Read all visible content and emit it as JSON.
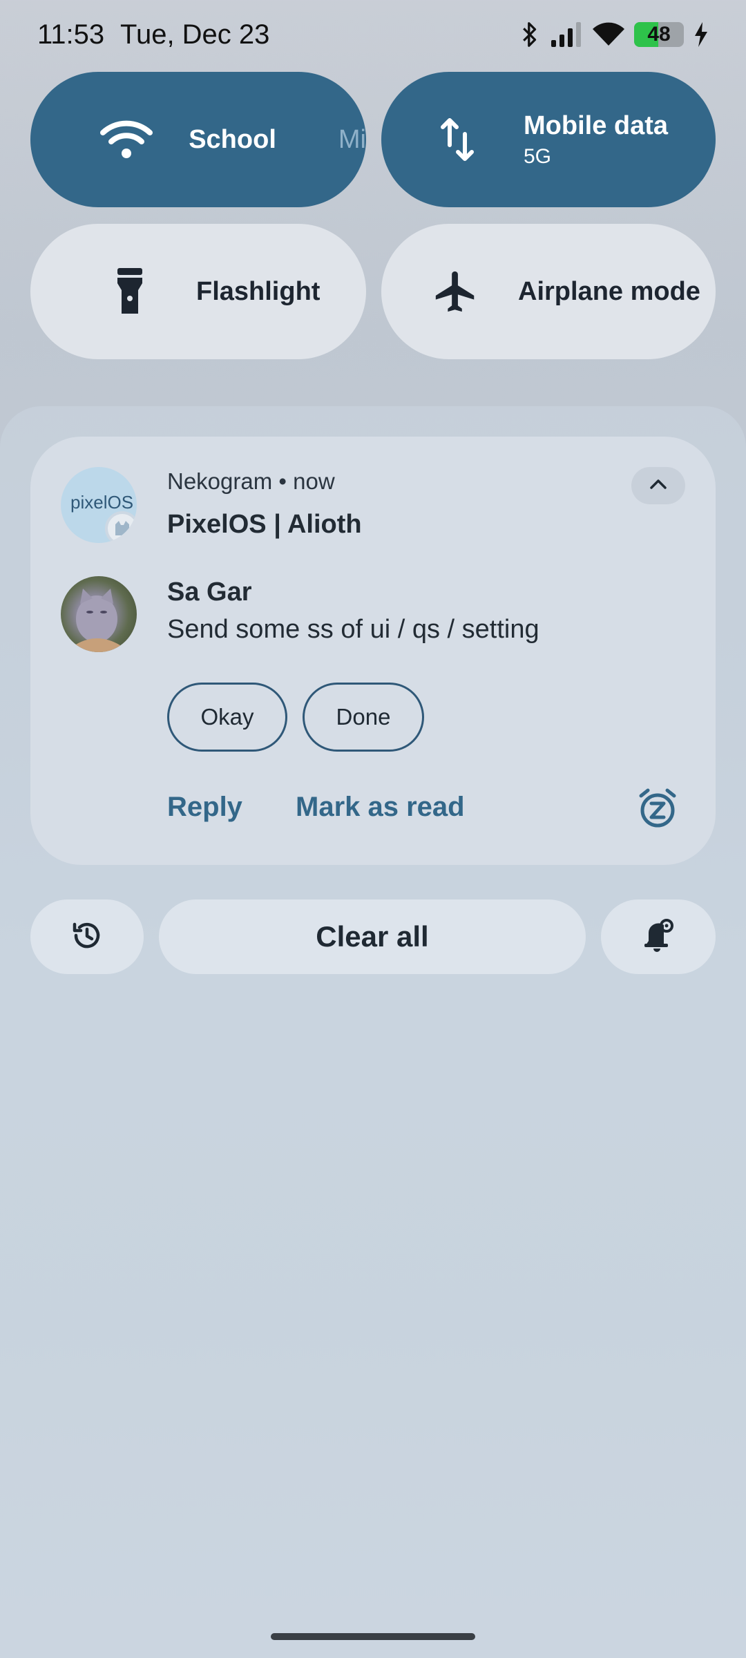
{
  "status_bar": {
    "time": "11:53",
    "date": "Tue, Dec 23",
    "battery_level": "48",
    "battery_percent": 0.48,
    "icons": [
      "bluetooth-icon",
      "signal-icon",
      "wifi-icon",
      "battery-icon",
      "charging-icon"
    ]
  },
  "quick_settings": {
    "tiles": [
      {
        "label": "School",
        "extra": "Mi",
        "state": "on",
        "icon": "wifi-icon"
      },
      {
        "label": "Mobile data",
        "sub": "5G",
        "state": "on",
        "icon": "mobile-data-icon"
      },
      {
        "label": "Flashlight",
        "state": "off",
        "icon": "flashlight-icon"
      },
      {
        "label": "Airplane mode",
        "state": "off",
        "icon": "airplane-icon"
      }
    ]
  },
  "notification": {
    "app_name": "Nekogram • now",
    "app_icon_text": "pixelOS",
    "channel_title": "PixelOS | Alioth",
    "sender": "Sa Gar",
    "message": "Send some ss of ui / qs / setting",
    "quick_replies": [
      "Okay",
      "Done"
    ],
    "actions": [
      "Reply",
      "Mark as read"
    ]
  },
  "footer": {
    "clear_all": "Clear all",
    "icons": [
      "history-icon",
      "notification-settings-icon"
    ]
  },
  "colors": {
    "accent": "#336789",
    "tile_inactive": "#e0e4ea",
    "card": "#d6dde6"
  }
}
